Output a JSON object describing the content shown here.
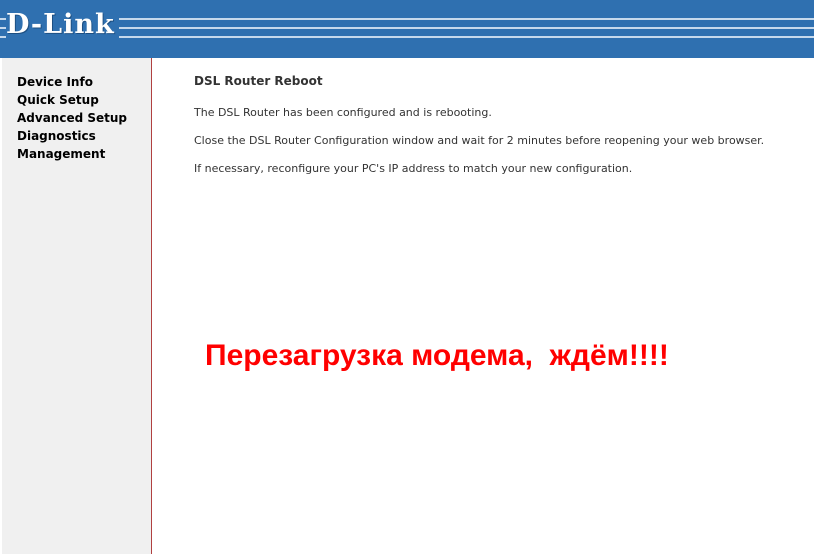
{
  "header": {
    "logo_text": "D-Link",
    "brand_color": "#2f70b0"
  },
  "sidebar": {
    "items": [
      {
        "label": "Device Info"
      },
      {
        "label": "Quick Setup"
      },
      {
        "label": "Advanced Setup"
      },
      {
        "label": "Diagnostics"
      },
      {
        "label": "Management"
      }
    ]
  },
  "main": {
    "title": "DSL Router Reboot",
    "lines": [
      "The DSL Router has been configured and is rebooting.",
      "Close the DSL Router Configuration window and wait for 2 minutes before reopening your web browser.",
      "If necessary, reconfigure your PC's IP address to match your new configuration."
    ]
  },
  "overlay": {
    "text": "Перезагрузка модема,  ждём!!!!",
    "color": "#ff0000"
  }
}
